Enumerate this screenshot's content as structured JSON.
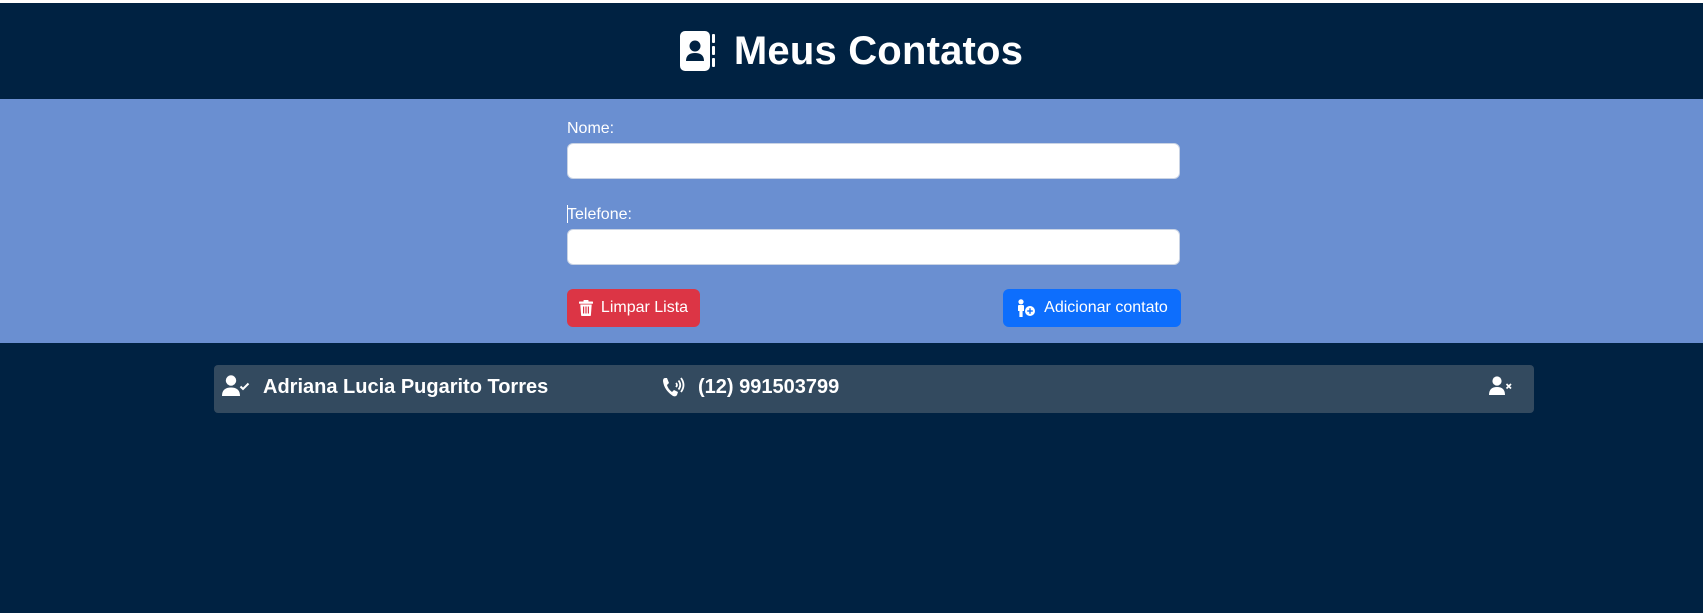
{
  "header": {
    "title": "Meus Contatos",
    "icon": "contact-book-icon"
  },
  "form": {
    "name_label": "Nome:",
    "name_value": "",
    "phone_label": "Telefone:",
    "phone_value": "",
    "clear_button": {
      "label": "Limpar Lista",
      "icon": "trash-icon"
    },
    "add_button": {
      "label": "Adicionar contato",
      "icon": "person-add-icon"
    }
  },
  "contacts": [
    {
      "name": "Adriana Lucia Pugarito Torres",
      "phone": "(12) 991503799"
    }
  ],
  "colors": {
    "background": "#002242",
    "form_band": "#6a8fd1",
    "clear_button": "#dc3545",
    "add_button": "#0d6efd",
    "row": "#334a5f"
  }
}
